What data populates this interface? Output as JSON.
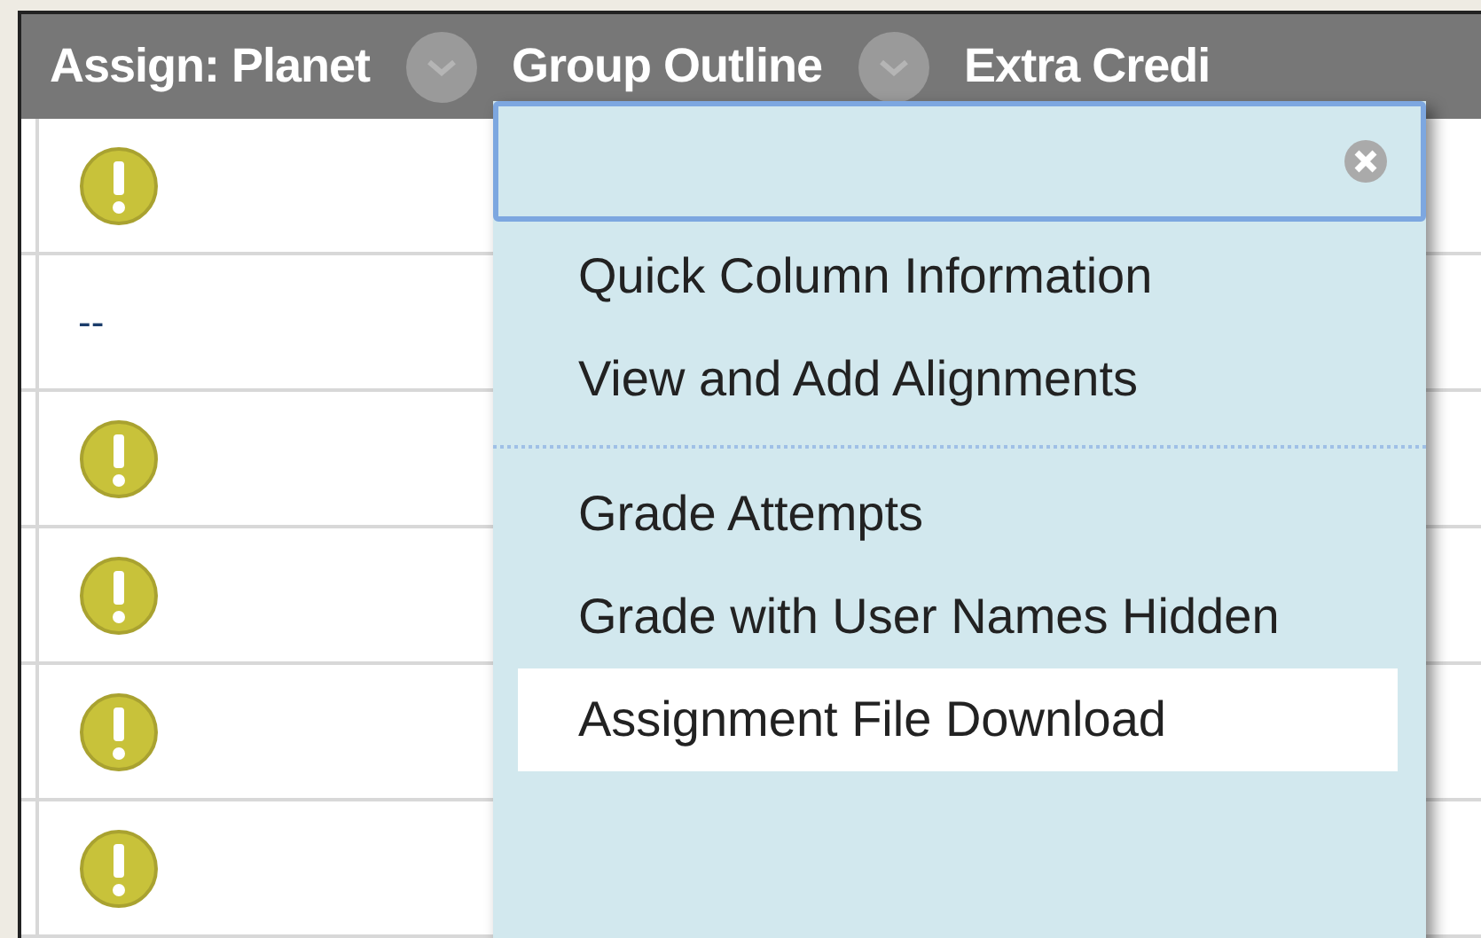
{
  "table": {
    "columns": [
      {
        "label": "Assign: Planet"
      },
      {
        "label": "Group Outline"
      },
      {
        "label": "Extra Credi"
      }
    ],
    "rows": [
      {
        "kind": "needs-grading"
      },
      {
        "kind": "text",
        "text": "--"
      },
      {
        "kind": "needs-grading"
      },
      {
        "kind": "needs-grading"
      },
      {
        "kind": "needs-grading"
      },
      {
        "kind": "needs-grading"
      }
    ]
  },
  "menu": {
    "sections": [
      [
        {
          "label": "Quick Column Information",
          "selected": false
        },
        {
          "label": "View and Add Alignments",
          "selected": false
        }
      ],
      [
        {
          "label": "Grade Attempts",
          "selected": false
        },
        {
          "label": "Grade with User Names Hidden",
          "selected": false
        },
        {
          "label": "Assignment File Download",
          "selected": true
        }
      ]
    ]
  }
}
